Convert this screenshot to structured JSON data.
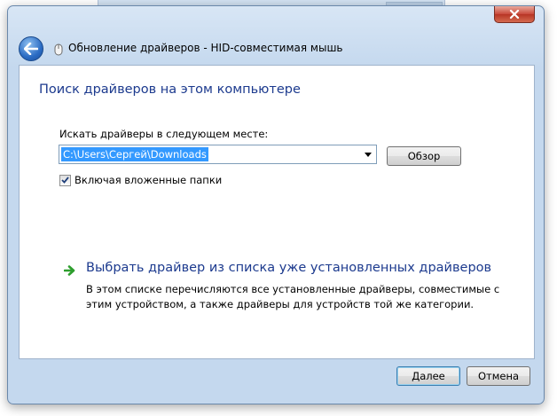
{
  "window": {
    "title": "Обновление драйверов - HID-совместимая мышь"
  },
  "page": {
    "heading": "Поиск драйверов на этом компьютере",
    "search_label": "Искать драйверы в следующем месте:",
    "path_value": "C:\\Users\\Сергей\\Downloads",
    "browse_label": "Обзор",
    "include_subfolders_label": "Включая вложенные папки",
    "include_subfolders_checked": true,
    "pick_link": "Выбрать драйвер из списка уже установленных драйверов",
    "pick_description": "В этом списке перечисляются все установленные драйверы, совместимые с этим устройством, а также драйверы для устройств той же категории."
  },
  "footer": {
    "next_label": "Далее",
    "cancel_label": "Отмена"
  },
  "icons": {
    "back": "back-arrow-icon",
    "device": "mouse-device-icon",
    "close": "close-icon",
    "dropdown": "chevron-down-icon",
    "check": "checkmark-icon",
    "link_arrow": "green-arrow-icon"
  },
  "colors": {
    "heading": "#1c3a8e",
    "selection": "#3399ff",
    "link_arrow": "#2e9e2e",
    "close_button": "#c8493a"
  }
}
